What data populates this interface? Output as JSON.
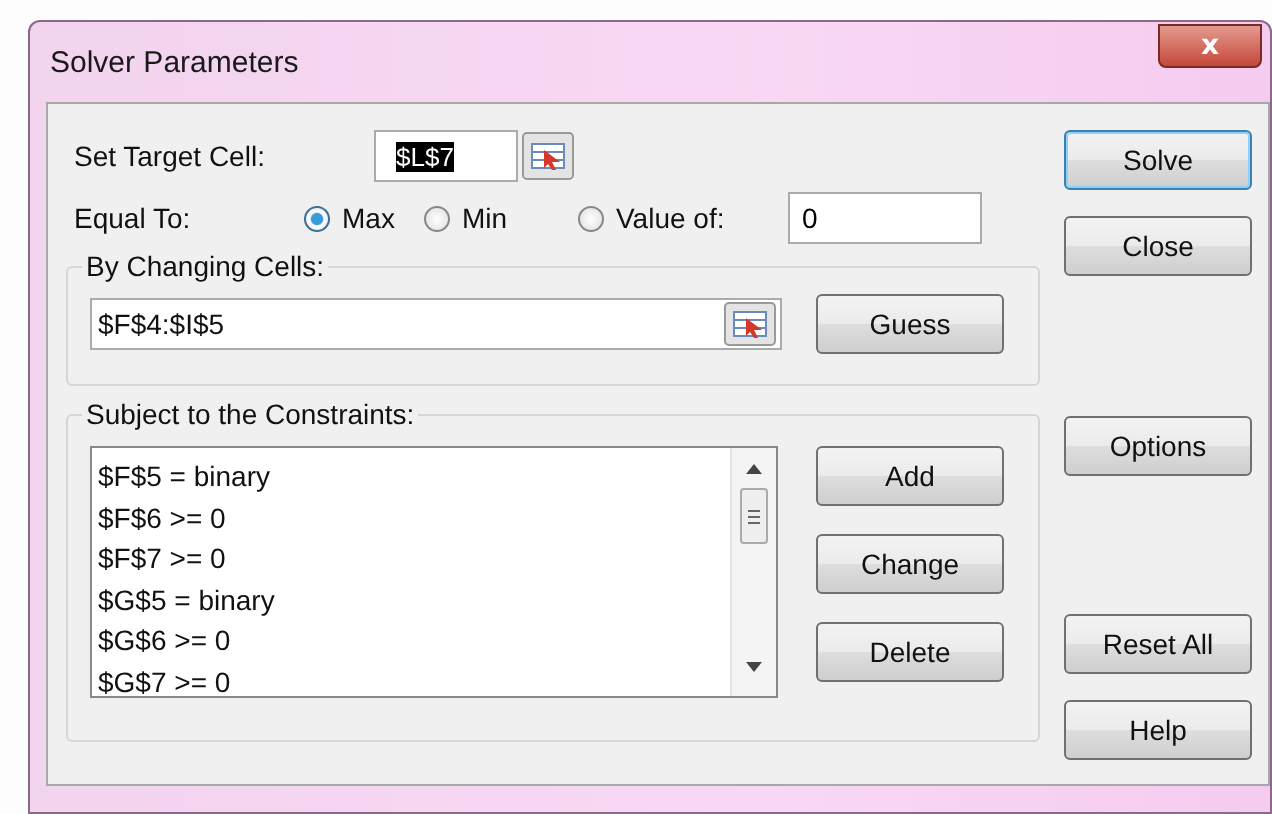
{
  "window": {
    "title": "Solver Parameters",
    "close": "x"
  },
  "target": {
    "label": "Set Target Cell:",
    "value": "$L$7"
  },
  "equal_to": {
    "label": "Equal To:",
    "options": [
      {
        "label": "Max",
        "selected": true
      },
      {
        "label": "Min",
        "selected": false
      },
      {
        "label": "Value of:",
        "selected": false
      }
    ],
    "value": "0"
  },
  "changing": {
    "label": "By Changing Cells:",
    "value": "$F$4:$I$5",
    "button": "Guess"
  },
  "constraints": {
    "label": "Subject to the Constraints:",
    "items": [
      "$F$5 = binary",
      "$F$6 >= 0",
      "$F$7 >= 0",
      "$G$5 = binary",
      "$G$6 >= 0",
      "$G$7 >= 0"
    ],
    "buttons": [
      "Add",
      "Change",
      "Delete"
    ]
  },
  "side_buttons": [
    {
      "label": "Solve",
      "default": true
    },
    {
      "label": "Close",
      "default": false
    },
    {
      "label": "Options",
      "default": false
    },
    {
      "label": "Reset All",
      "default": false
    },
    {
      "label": "Help",
      "default": false
    }
  ]
}
